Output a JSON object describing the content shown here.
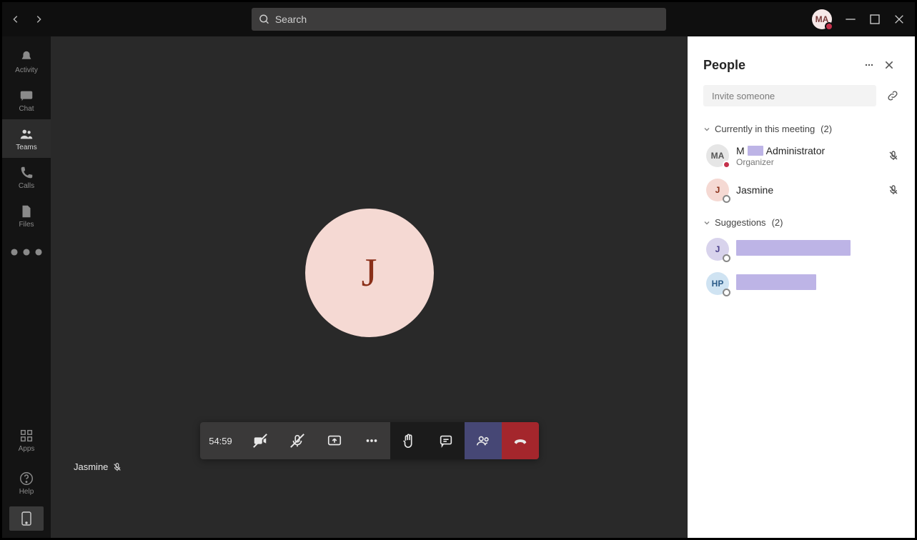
{
  "search": {
    "placeholder": "Search"
  },
  "avatar_initials": "MA",
  "rail": {
    "activity": "Activity",
    "chat": "Chat",
    "teams": "Teams",
    "calls": "Calls",
    "files": "Files",
    "apps": "Apps",
    "help": "Help"
  },
  "stage": {
    "main_participant_initial": "J",
    "participant_name": "Jasmine"
  },
  "controls": {
    "timer": "54:59"
  },
  "panel": {
    "title": "People",
    "invite_placeholder": "Invite someone",
    "current_label": "Currently in this meeting",
    "current_count": "(2)",
    "suggestions_label": "Suggestions",
    "suggestions_count": "(2)",
    "people": {
      "organizer": {
        "initials": "MA",
        "name_prefix": "M",
        "name_suffix": "Administrator",
        "role": "Organizer"
      },
      "member1": {
        "initials": "J",
        "name": "Jasmine"
      }
    },
    "suggestions": {
      "s1": {
        "initials": "J"
      },
      "s2": {
        "initials": "HP"
      }
    }
  }
}
